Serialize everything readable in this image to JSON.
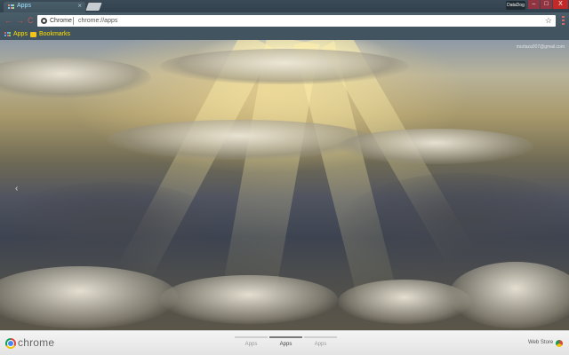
{
  "tab": {
    "title": "Apps",
    "close_glyph": "×"
  },
  "window": {
    "profile_label": "DataDog",
    "minimize_glyph": "–",
    "maximize_glyph": "□",
    "close_glyph": "X"
  },
  "toolbar": {
    "back_glyph": "←",
    "forward_glyph": "→",
    "reload_glyph": "C",
    "site_chip": "Chrome",
    "url": "chrome://apps",
    "star_glyph": "☆"
  },
  "bookmarks": [
    {
      "label": "Apps",
      "icon": "apps-grid-icon"
    },
    {
      "label": "Bookmarks",
      "icon": "folder-icon"
    }
  ],
  "content": {
    "user_email": "murtaza007@gmail.com",
    "prev_page_glyph": "‹"
  },
  "footer": {
    "brand": "chrome",
    "pages": [
      {
        "label": "Apps",
        "active": false
      },
      {
        "label": "Apps",
        "active": true
      },
      {
        "label": "Apps",
        "active": false
      }
    ],
    "web_store_label": "Web Store"
  },
  "colors": {
    "tab_title": "#9fe1ff",
    "bookmark_text": "#ffe000",
    "nav_icons": "#c4545a",
    "close_button": "#c22a2a"
  }
}
